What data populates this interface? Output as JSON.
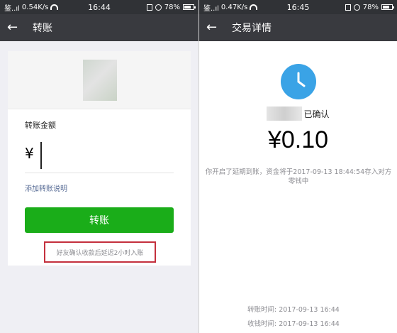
{
  "left": {
    "status": {
      "carrier": "鉴..ıl",
      "speed": "0.54K/s",
      "time": "16:44",
      "battery": "78%",
      "battery_level": 0.78
    },
    "nav": {
      "title": "转账"
    },
    "amount_label": "转账金额",
    "currency_symbol": "¥",
    "add_note_link": "添加转账说明",
    "transfer_button": "转账",
    "delay_note": "好友确认收款后延迟2小时入账"
  },
  "right": {
    "status": {
      "carrier": "鉴..ıl",
      "speed": "0.47K/s",
      "time": "16:45",
      "battery": "78%",
      "battery_level": 0.78
    },
    "nav": {
      "title": "交易详情"
    },
    "confirmed_text": "已确认",
    "amount": "¥0.10",
    "info_text": "你开启了延期到账，资金将于2017-09-13 18:44:54存入对方零钱中",
    "transfer_time_label": "转账时间:",
    "transfer_time_value": "2017-09-13 16:44",
    "receive_time_label": "收钱时间:",
    "receive_time_value": "2017-09-13 16:44",
    "accent_color": "#1aad19",
    "clock_color": "#3aa3e6",
    "highlight_color": "#c4303d"
  }
}
